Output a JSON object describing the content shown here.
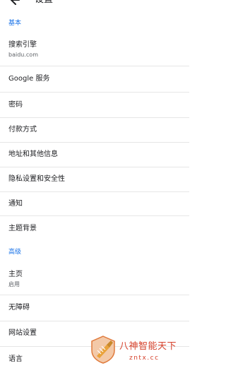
{
  "topbar": {
    "back_icon": "back-arrow-icon",
    "title": "设置"
  },
  "sections": {
    "basic": "基本",
    "advanced": "高级"
  },
  "rows": {
    "search_engine": {
      "title": "搜索引擎",
      "subtitle": "baidu.com"
    },
    "google_services": {
      "title": "Google 服务"
    },
    "passwords": {
      "title": "密码"
    },
    "payment": {
      "title": "付款方式"
    },
    "addresses": {
      "title": "地址和其他信息"
    },
    "privacy": {
      "title": "隐私设置和安全性"
    },
    "notifications": {
      "title": "通知"
    },
    "themes": {
      "title": "主题背景"
    },
    "homepage": {
      "title": "主页",
      "subtitle": "启用"
    },
    "accessibility": {
      "title": "无障碍"
    },
    "site_settings": {
      "title": "网站设置"
    },
    "languages": {
      "title": "语言"
    }
  },
  "watermark": {
    "title": "八神智能天下",
    "url": "zntx.cc"
  },
  "colors": {
    "accent": "#1a73e8",
    "text_primary": "#202124",
    "text_secondary": "#5f6368",
    "divider": "#e6e6e6",
    "watermark": "#d6422c"
  }
}
